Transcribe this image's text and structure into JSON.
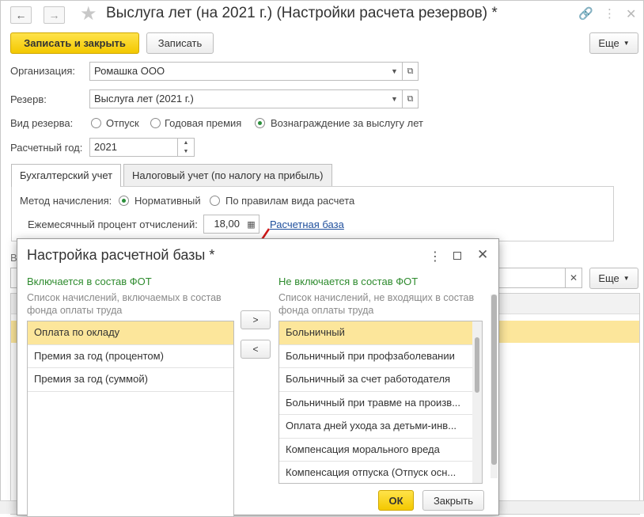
{
  "window": {
    "title": "Выслуга лет (на 2021 г.) (Настройки расчета резервов) *"
  },
  "toolbar": {
    "save_close": "Записать и закрыть",
    "save": "Записать",
    "more": "Еще"
  },
  "form": {
    "org_label": "Организация:",
    "org_value": "Ромашка ООО",
    "reserve_label": "Резерв:",
    "reserve_value": "Выслуга лет (2021 г.)",
    "type_label": "Вид резерва:",
    "type_options": [
      "Отпуск",
      "Годовая премия",
      "Вознаграждение за выслугу лет"
    ],
    "type_selected": "Вознаграждение за выслугу лет",
    "year_label": "Расчетный год:",
    "year_value": "2021"
  },
  "tabs": [
    "Бухгалтерский учет",
    "Налоговый учет (по налогу на прибыль)"
  ],
  "accounting": {
    "method_label": "Метод начисления:",
    "method_options": [
      "Нормативный",
      "По правилам вида расчета"
    ],
    "method_selected": "Нормативный",
    "percent_label": "Ежемесячный процент отчислений:",
    "percent_value": "18,00",
    "base_link": "Расчетная база"
  },
  "background_more": "Еще",
  "dialog": {
    "title": "Настройка расчетной базы *",
    "left_header": "Включается в состав ФОТ",
    "left_hint": "Список начислений, включаемых в состав фонда оплаты труда",
    "left_items": [
      "Оплата по окладу",
      "Премия за год (процентом)",
      "Премия за год (суммой)"
    ],
    "right_header": "Не включается в состав ФОТ",
    "right_hint": "Список начислений, не входящих в состав фонда оплаты труда",
    "right_items": [
      "Больничный",
      "Больничный при профзаболевании",
      "Больничный за счет работодателя",
      "Больничный при травме на произв...",
      "Оплата дней ухода за детьми-инв...",
      "Компенсация морального вреда",
      "Компенсация отпуска (Отпуск осн..."
    ],
    "move_right": ">",
    "move_left": "<",
    "ok": "ОК",
    "close": "Закрыть"
  },
  "colors": {
    "accent_yellow": "#f3c800",
    "selection": "#fce69b",
    "green_header": "#2e8b2e",
    "link": "#1f4f9c",
    "annotation_arrow": "#d01818"
  }
}
